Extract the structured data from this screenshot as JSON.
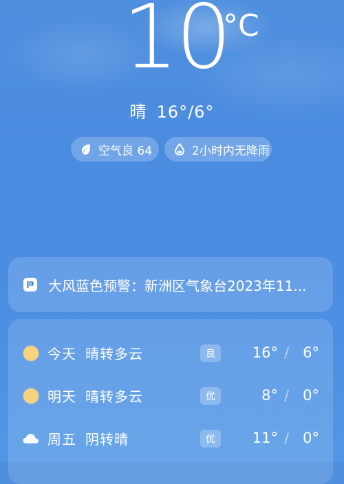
{
  "current": {
    "temperature": "10",
    "unit": "°C",
    "condition": "晴",
    "high": "16°",
    "low": "6°",
    "separator": "/"
  },
  "chips": {
    "air_quality": "空气良 64",
    "rain_forecast": "2小时内无降雨"
  },
  "alert": {
    "text": "大风蓝色预警：新洲区气象台2023年11..."
  },
  "forecast": [
    {
      "day": "今天",
      "weather": "晴转多云",
      "air": "良",
      "high": "16°",
      "low": "6°",
      "icon": "sun-icon"
    },
    {
      "day": "明天",
      "weather": "晴转多云",
      "air": "优",
      "high": "8°",
      "low": "0°",
      "icon": "sun-icon"
    },
    {
      "day": "周五",
      "weather": "阴转晴",
      "air": "优",
      "high": "11°",
      "low": "0°",
      "icon": "cloud-icon"
    }
  ],
  "forecast_separator": "/",
  "colors": {
    "sky": "#4a8ce0",
    "sun": "#f8d27e",
    "alert_icon": "#2f7fd8"
  }
}
